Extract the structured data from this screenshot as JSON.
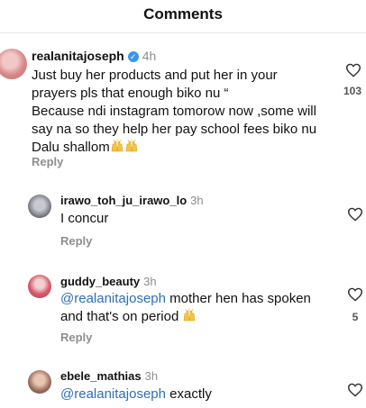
{
  "header": {
    "title": "Comments"
  },
  "comments": [
    {
      "username": "realanitajoseph",
      "time": "4h",
      "verified": true,
      "lines": [
        "Just buy her products and put her in your",
        "prayers pls that enough biko nu “",
        "Because ndi instagram tomorow now ,some will",
        "say na so they help her pay school fees biko nu",
        "Dalu shallom"
      ],
      "emojis": [
        "raising-hands",
        "raising-hands"
      ],
      "reply": "Reply",
      "likes": "103"
    },
    {
      "username": "irawo_toh_ju_irawo_lo",
      "time": "3h",
      "text": "I concur",
      "reply": "Reply",
      "likes": ""
    },
    {
      "username": "guddy_beauty",
      "time": "3h",
      "mention": "@realanitajoseph",
      "text_line1": " mother hen has spoken",
      "text_line2": "and that's on period",
      "emojis": [
        "raising-hands"
      ],
      "reply": "Reply",
      "likes": "5"
    },
    {
      "username": "ebele_mathias",
      "time": "3h",
      "mention": "@realanitajoseph",
      "text": " exactly",
      "likes": ""
    }
  ],
  "colors": {
    "mention": "#2d6fb7",
    "verified": "#3797f0",
    "muted": "#8e8e8e"
  },
  "icons": {
    "like": "heart-icon",
    "verified": "verified-badge-icon",
    "emoji": "raising-hands-emoji"
  }
}
